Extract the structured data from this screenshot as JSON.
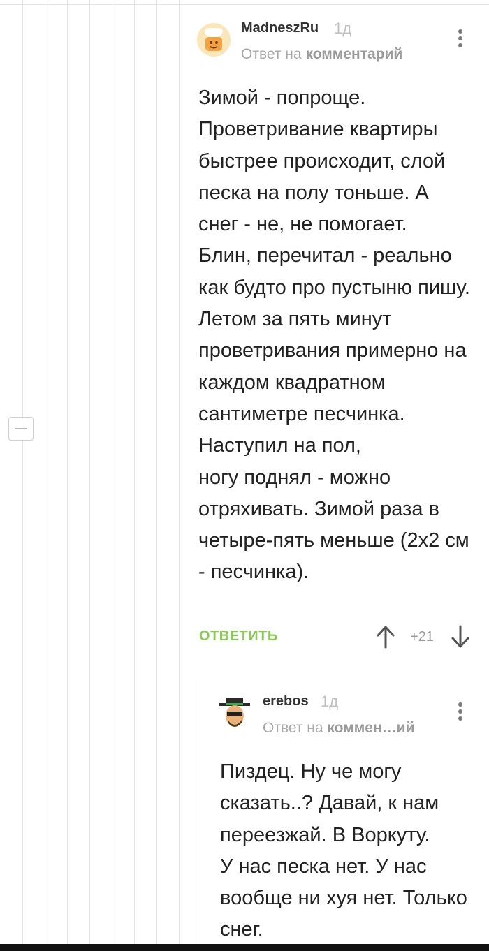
{
  "comments": [
    {
      "author": "MadneszRu",
      "age": "1д",
      "reply_prefix": "Ответ на",
      "reply_target": "комментарий",
      "text": "Зимой - попроще.\nПроветривание квартиры быстрее происходит, слой песка на полу тоньше. А снег - не, не помогает.\nБлин, перечитал - реально как будто про пустыню пишу.\nЛетом за пять минут проветривания примерно на каждом квадратном сантиметре песчинка. Наступил на пол,\nногу поднял - можно отряхивать. Зимой раза в четыре-пять меньше (2х2 см - песчинка).",
      "reply_label": "ОТВЕТИТЬ",
      "rating": "+21",
      "avatar_icon": "chef-avatar-icon"
    },
    {
      "author": "erebos",
      "age": "1д",
      "reply_prefix": "Ответ на",
      "reply_target": "коммен…ий",
      "text": "Пиздец. Ну че могу сказать..? Давай, к нам переезжай. В Воркуту.\nУ нас песка нет. У нас вообще ни хуя нет. Только снег.",
      "avatar_icon": "heisenberg-avatar-icon"
    }
  ],
  "icons": {
    "collapse": "minus-icon",
    "menu": "more-vertical-icon",
    "upvote": "arrow-up-icon",
    "downvote": "arrow-down-icon"
  },
  "colors": {
    "accent": "#8ac858",
    "meta": "#a8a8a8",
    "thread_line": "#e2e2e2"
  }
}
